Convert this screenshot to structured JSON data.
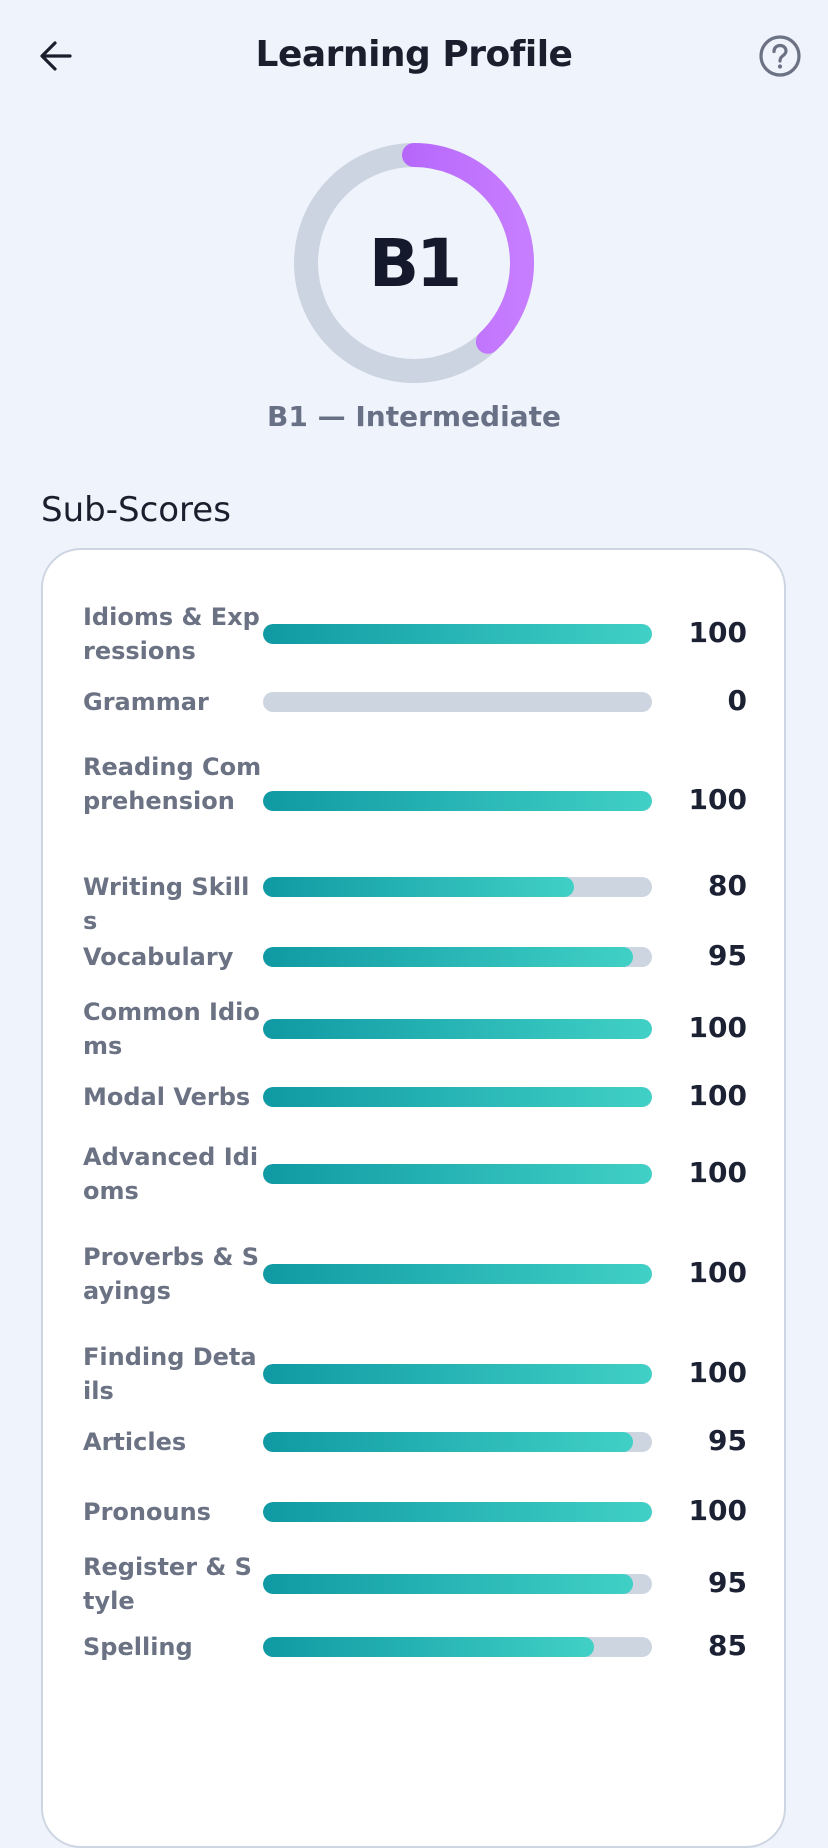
{
  "header": {
    "title": "Learning Profile",
    "back_icon": "arrow-left-icon",
    "help_icon": "help-circle-icon"
  },
  "level": {
    "code": "B1",
    "caption": "B1 — Intermediate",
    "progress": 0.38,
    "ring_track_color": "#cbd4e0",
    "ring_gradient": [
      "#a855f7",
      "#c77dff"
    ]
  },
  "subscores": {
    "title": "Sub-Scores",
    "fill_gradient": [
      "#0f9aa3",
      "#41d0c6"
    ],
    "items": [
      {
        "label": "Idioms & Expressions",
        "value": "100",
        "percent": 100
      },
      {
        "label": "Grammar",
        "value": "0",
        "percent": 0
      },
      {
        "label": "Reading Comprehension",
        "value": "100",
        "percent": 100
      },
      {
        "label": "Writing Skills",
        "value": "80",
        "percent": 80
      },
      {
        "label": "Vocabulary",
        "value": "95",
        "percent": 95
      },
      {
        "label": "Common Idioms",
        "value": "100",
        "percent": 100
      },
      {
        "label": "Modal Verbs",
        "value": "100",
        "percent": 100
      },
      {
        "label": "Advanced Idioms",
        "value": "100",
        "percent": 100
      },
      {
        "label": "Proverbs & Sayings",
        "value": "100",
        "percent": 100
      },
      {
        "label": "Finding Details",
        "value": "100",
        "percent": 100
      },
      {
        "label": "Articles",
        "value": "95",
        "percent": 95
      },
      {
        "label": "Pronouns",
        "value": "100",
        "percent": 100
      },
      {
        "label": "Register & Style",
        "value": "95",
        "percent": 95
      },
      {
        "label": "Spelling",
        "value": "85",
        "percent": 85
      }
    ]
  }
}
